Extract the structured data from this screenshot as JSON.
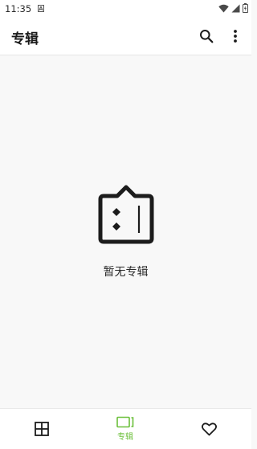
{
  "status_bar": {
    "time": "11:35",
    "notification_glyph": "A",
    "icons": [
      "wifi-icon",
      "cell-signal-icon",
      "battery-icon"
    ]
  },
  "app_bar": {
    "title": "专辑",
    "actions": [
      "search-icon",
      "more-vertical-icon"
    ]
  },
  "empty_state": {
    "icon": "album-tv-icon",
    "message": "暂无专辑"
  },
  "bottom_nav": {
    "accent_color": "#6bbf3a",
    "items": [
      {
        "icon": "grid-icon",
        "label": "",
        "selected": false
      },
      {
        "icon": "album-icon",
        "label": "专辑",
        "selected": true
      },
      {
        "icon": "heart-icon",
        "label": "",
        "selected": false
      }
    ]
  }
}
